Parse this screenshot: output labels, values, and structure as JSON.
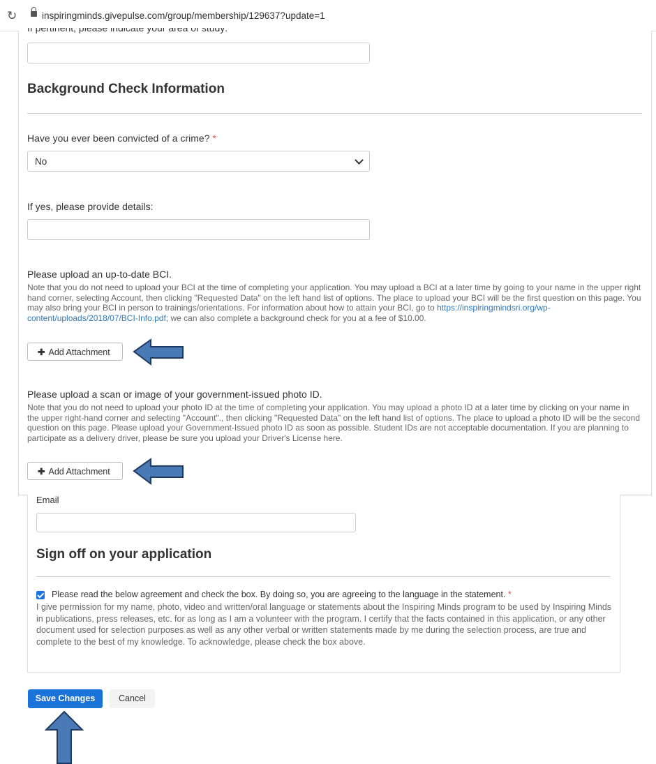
{
  "browser": {
    "url": "inspiringminds.givepulse.com/group/membership/129637?update=1"
  },
  "form": {
    "clipped_field_label": "If pertinent, please indicate your area of study:",
    "background_section_title": "Background Check Information",
    "crime_question": "Have you ever been convicted of a crime?",
    "required_mark": "*",
    "crime_selected": "No",
    "details_label": "If yes, please provide details:",
    "bci_label": "Please upload an up-to-date BCI.",
    "bci_note_before_link": "Note that you do not need to upload your BCI at the time of completing your application. You may upload a BCI at a later time by going to your name in the upper right hand corner, selecting Account, then clicking \"Requested Data\" on the left hand list of options. The place to upload your BCI will be the first question on this page. You may also bring your BCI in person to trainings/orientations. For information about how to attain your BCI, go to",
    "bci_link": "https://inspiringmindsri.org/wp-content/uploads/2018/07/BCI-Info.pdf",
    "bci_note_after_link": "; we can also complete a background check for you at a fee of $10.00.",
    "add_attachment_label": "Add Attachment",
    "photo_id_label": "Please upload a scan or image of your government-issued photo ID.",
    "photo_id_note": "Note that you do not need to upload your photo ID at the time of completing your application. You may upload a photo ID at a later time by clicking on your name in the upper right-hand corner and selecting \"Account\"., then clicking \"Requested Data\" on the left hand list of options. The place to upload a photo ID will be the second question on this page. Please upload your Government-Issued photo ID as soon as possible. Student IDs are not acceptable documentation. If you are planning to participate as a delivery driver, please be sure you upload your Driver's License here.",
    "email_label": "Email",
    "signoff_title": "Sign off on your application",
    "agreement_label": "Please read the below agreement and check the box. By doing so, you are agreeing to the language in the statement.",
    "agreement_checked": true,
    "agreement_text": "I give permission for my name, photo, video and written/oral language or statements about the Inspiring Minds program to be used by Inspiring Minds in publications, press releases, etc. for as long as I am a volunteer with the program. I certify that the facts contained in this application, or any other document used for selection purposes as well as any other verbal or written statements made by me during the selection process, are true and complete to the best of my knowledge. To acknowledge, please check the box above.",
    "save_label": "Save Changes",
    "cancel_label": "Cancel"
  },
  "colors": {
    "arrow_fill": "#4a7ab5",
    "arrow_stroke": "#1f3a60",
    "primary_button": "#1a73d8",
    "required": "#d9534f",
    "link": "#337ab7"
  },
  "icons": [
    "reload-icon",
    "lock-icon",
    "chevron-down-icon",
    "plus-icon",
    "check-icon",
    "arrow-left-annotation",
    "arrow-up-annotation"
  ]
}
